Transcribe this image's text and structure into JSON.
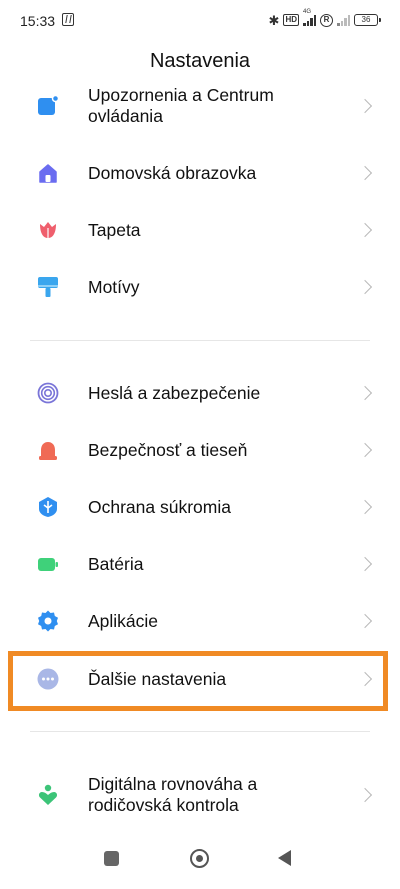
{
  "status_bar": {
    "time": "15:33",
    "network_label": "4G",
    "battery": "36"
  },
  "page_title": "Nastavenia",
  "colors": {
    "highlight": "#f08a24",
    "notifications_icon": "#2f8ff0",
    "home_icon": "#6a6cf0",
    "wallpaper_icon": "#ef5f6d",
    "themes_icon": "#3aa6ee",
    "passwords_icon": "#7a75d8",
    "safety_icon": "#f06a55",
    "privacy_icon": "#2f8ff0",
    "battery_icon": "#3fd17a",
    "apps_icon": "#2f8ff0",
    "more_icon": "#a9b7e6",
    "wellbeing_icon": "#3cc478"
  },
  "items": [
    {
      "label": "Upozornenia a Centrum ovládania",
      "icon": "notifications-icon"
    },
    {
      "label": "Domovská obrazovka",
      "icon": "home-icon"
    },
    {
      "label": "Tapeta",
      "icon": "wallpaper-icon"
    },
    {
      "label": "Motívy",
      "icon": "themes-icon"
    },
    {
      "label": "Heslá a zabezpečenie",
      "icon": "fingerprint-icon"
    },
    {
      "label": "Bezpečnosť a tieseň",
      "icon": "emergency-siren-icon"
    },
    {
      "label": "Ochrana súkromia",
      "icon": "privacy-shield-icon"
    },
    {
      "label": "Batéria",
      "icon": "battery-icon"
    },
    {
      "label": "Aplikácie",
      "icon": "apps-gear-icon"
    },
    {
      "label": "Ďalšie nastavenia",
      "icon": "more-settings-icon"
    },
    {
      "label": "Digitálna rovnováha a rodičovská kontrola",
      "icon": "wellbeing-icon"
    }
  ]
}
